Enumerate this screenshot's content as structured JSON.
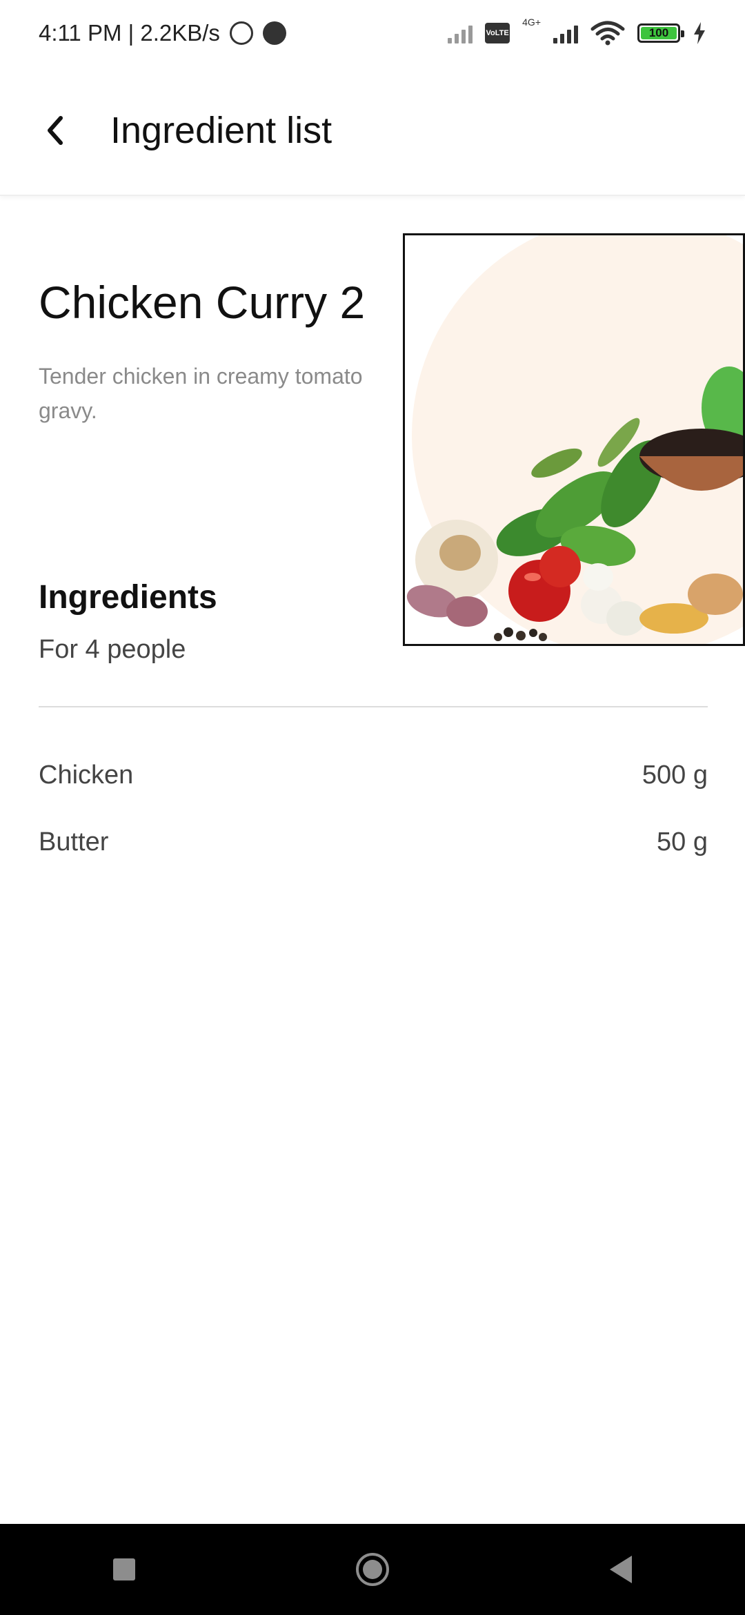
{
  "status_bar": {
    "time_speed": "4:11 PM | 2.2KB/s",
    "volte": "Vo\nLTE",
    "network": "4G+",
    "battery": "100"
  },
  "app_bar": {
    "back_icon": "‹",
    "title": "Ingredient list"
  },
  "recipe": {
    "title": "Chicken Curry 2",
    "description": "Tender chicken in creamy tomato gravy.",
    "image": "fresh-vegetables-and-spices"
  },
  "ingredients_section": {
    "title": "Ingredients",
    "servings": "For 4 people",
    "items": [
      {
        "name": "Chicken",
        "amount": "500 g"
      },
      {
        "name": "Butter",
        "amount": "50 g"
      }
    ]
  },
  "colors": {
    "title": "#111111",
    "secondary_text": "#8a8a8a",
    "body_text": "#444444",
    "divider": "#dcdcdc",
    "navbar": "#000000"
  },
  "nav_bar": {
    "icons": [
      "recents-square-icon",
      "home-circle-icon",
      "back-triangle-icon"
    ]
  }
}
